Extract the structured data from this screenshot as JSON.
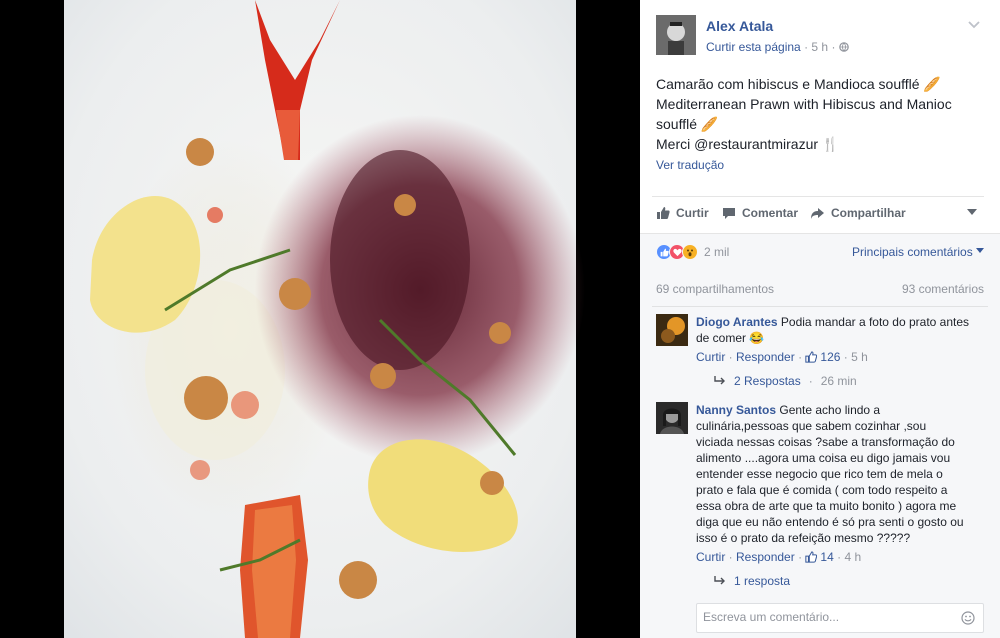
{
  "colors": {
    "link": "#365899",
    "muted": "#90949c",
    "like_blue": "#5890ff",
    "love_red": "#f25268",
    "wow_yellow": "#f7b125"
  },
  "post": {
    "author": "Alex Atala",
    "like_page_link": "Curtir esta página",
    "time": "5 h",
    "privacy_icon": "globe-icon",
    "text_lines": [
      "Camarão com hibiscus e Mandioca soufflé 🥖",
      "Mediterranean Prawn with Hibiscus and Manioc",
      "soufflé 🥖",
      "Merci @restaurantmirazur 🍴"
    ],
    "see_translation": "Ver tradução"
  },
  "actions": {
    "like": "Curtir",
    "comment": "Comentar",
    "share": "Compartilhar"
  },
  "reactions": {
    "icons": [
      "like-icon",
      "love-icon",
      "wow-icon"
    ],
    "count": "2 mil",
    "sort_label": "Principais comentários"
  },
  "stats": {
    "shares": "69 compartilhamentos",
    "comments": "93 comentários"
  },
  "comments": [
    {
      "author": "Diogo Arantes",
      "text_lines": [
        "Podia mandar a foto do prato antes",
        "de comer 😂"
      ],
      "reply_label": "Curtir",
      "respond_label": "Responder",
      "likes": "126",
      "time": "5 h",
      "replies_label": "2 Respostas",
      "replies_time": "26 min"
    },
    {
      "author": "Nanny Santos",
      "text_lines": [
        "Gente acho lindo a",
        "culinária,pessoas que sabem cozinhar ,sou",
        "viciada nessas coisas ?sabe a transformação do",
        "alimento ....agora uma coisa eu digo jamais vou",
        "entender esse negocio que rico tem de mela o",
        "prato e fala que é comida ( com todo respeito a",
        "essa obra de arte que ta muito bonito ) agora me",
        "diga que eu não entendo é só pra senti o gosto ou",
        "isso é o prato da refeição mesmo ?????"
      ],
      "reply_label": "Curtir",
      "respond_label": "Responder",
      "likes": "14",
      "time": "4 h",
      "replies_label": "1 resposta",
      "replies_time": ""
    }
  ],
  "composer": {
    "placeholder": "Escreva um comentário..."
  }
}
